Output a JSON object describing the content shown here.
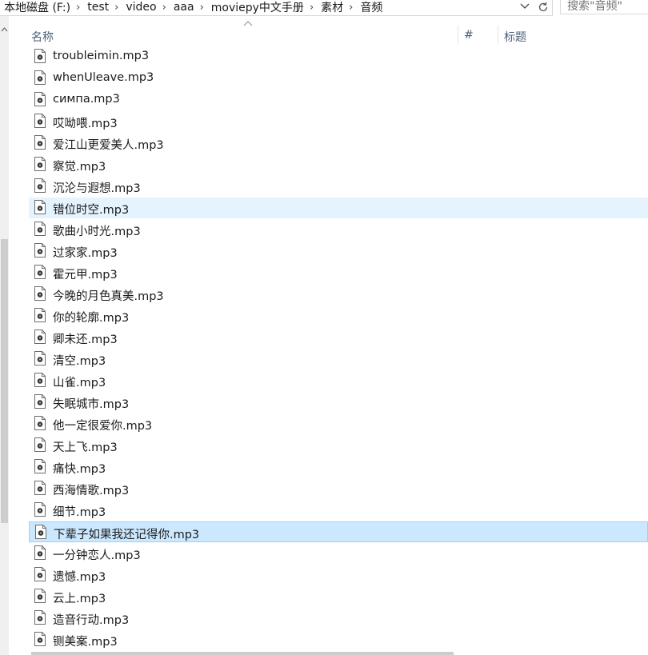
{
  "breadcrumb": [
    "本地磁盘 (F:)",
    "test",
    "video",
    "aaa",
    "moviepy中文手册",
    "素材",
    "音频"
  ],
  "search": {
    "placeholder": "搜索\"音频\""
  },
  "columns": {
    "name": "名称",
    "number": "#",
    "title": "标题"
  },
  "files": [
    "troubleimin.mp3",
    "whenUleave.mp3",
    "симпа.mp3",
    "哎呦喂.mp3",
    "爱江山更爱美人.mp3",
    "察觉.mp3",
    "沉沦与遐想.mp3",
    "错位时空.mp3",
    "歌曲小时光.mp3",
    "过家家.mp3",
    "霍元甲.mp3",
    "今晚的月色真美.mp3",
    "你的轮廓.mp3",
    "卿未还.mp3",
    "清空.mp3",
    "山雀.mp3",
    "失眠城市.mp3",
    "他一定很爱你.mp3",
    "天上飞.mp3",
    "痛快.mp3",
    "西海情歌.mp3",
    "细节.mp3",
    "下辈子如果我还记得你.mp3",
    "一分钟恋人.mp3",
    "遗憾.mp3",
    "云上.mp3",
    "造音行动.mp3",
    "铡美案.mp3"
  ],
  "hovered_index": 7,
  "selected_index": 22,
  "colors": {
    "selection": "#cce8ff",
    "selection_border": "#99d1ff",
    "hover": "#e5f3ff",
    "header_text": "#4c607a"
  },
  "icons": {
    "file": "audio-file-icon",
    "refresh": "refresh-icon",
    "dropdown": "chevron-down-icon",
    "sort": "sort-up-icon"
  }
}
